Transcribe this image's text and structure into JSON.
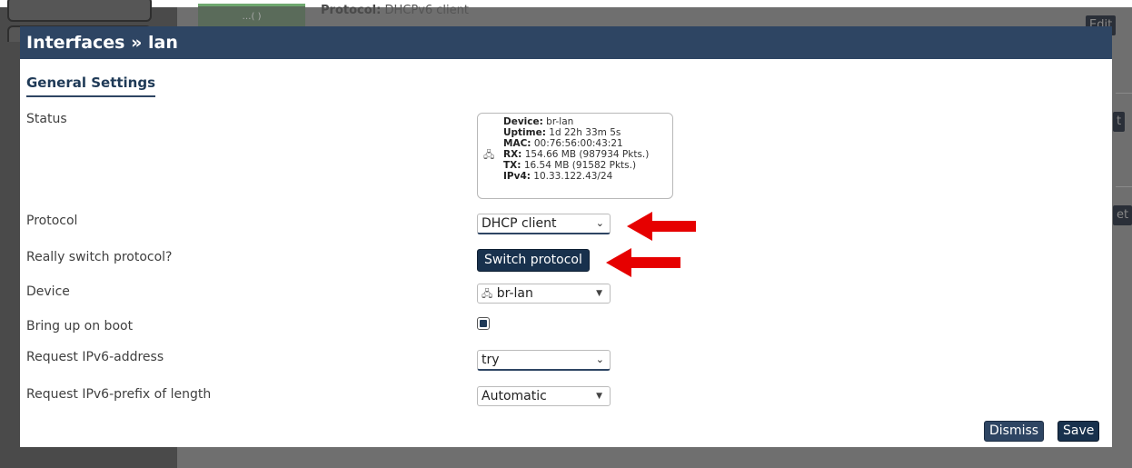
{
  "background": {
    "protocol_label": "Protocol:",
    "protocol_value": "DHCPv6 client",
    "iface_icon_text": "…( )",
    "edit_buttons": [
      "Edit",
      "t",
      "et"
    ]
  },
  "modal": {
    "title": "Interfaces » lan",
    "section": "General Settings",
    "status_label": "Status",
    "status": {
      "device_label": "Device:",
      "device": "br-lan",
      "uptime_label": "Uptime:",
      "uptime": "1d 22h 33m 5s",
      "mac_label": "MAC:",
      "mac": "00:76:56:00:43:21",
      "rx_label": "RX:",
      "rx": "154.66 MB (987934 Pkts.)",
      "tx_label": "TX:",
      "tx": "16.54 MB (91582 Pkts.)",
      "ipv4_label": "IPv4:",
      "ipv4": "10.33.122.43/24"
    },
    "protocol_label": "Protocol",
    "protocol_value": "DHCP client",
    "switch_label": "Really switch protocol?",
    "switch_button": "Switch protocol",
    "device_label": "Device",
    "device_value": "br-lan",
    "boot_label": "Bring up on boot",
    "boot_checked": true,
    "ipv6addr_label": "Request IPv6-address",
    "ipv6addr_value": "try",
    "ipv6prefix_label": "Request IPv6-prefix of length",
    "ipv6prefix_value": "Automatic",
    "dismiss_button": "Dismiss",
    "save_button": "Save"
  },
  "colors": {
    "header": "#2e4563",
    "arrow": "#e60000",
    "button_dark": "#18314d"
  }
}
